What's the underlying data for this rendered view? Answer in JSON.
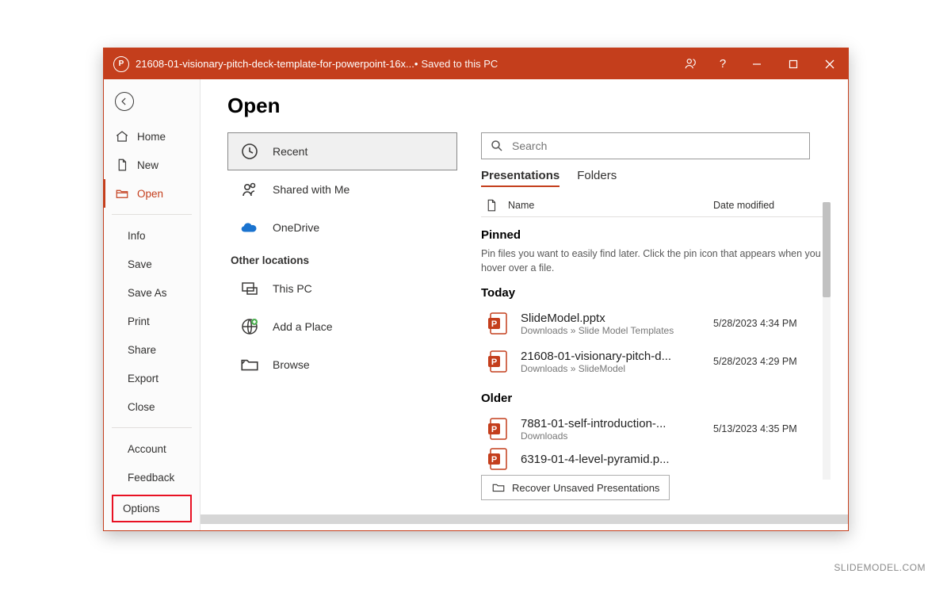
{
  "titlebar": {
    "filename": "21608-01-visionary-pitch-deck-template-for-powerpoint-16x...",
    "separator": " • ",
    "saved_status": "Saved to this PC",
    "help_label": "?"
  },
  "sidebar": {
    "home": "Home",
    "new": "New",
    "open": "Open",
    "info": "Info",
    "save": "Save",
    "save_as": "Save As",
    "print": "Print",
    "share": "Share",
    "export": "Export",
    "close": "Close",
    "account": "Account",
    "feedback": "Feedback",
    "options": "Options"
  },
  "main": {
    "page_title": "Open",
    "locations": {
      "recent": "Recent",
      "shared": "Shared with Me",
      "onedrive": "OneDrive",
      "other_label": "Other locations",
      "this_pc": "This PC",
      "add_place": "Add a Place",
      "browse": "Browse"
    },
    "search": {
      "placeholder": "Search"
    },
    "tabs": {
      "presentations": "Presentations",
      "folders": "Folders"
    },
    "columns": {
      "name": "Name",
      "date": "Date modified"
    },
    "groups": {
      "pinned": "Pinned",
      "pinned_hint": "Pin files you want to easily find later. Click the pin icon that appears when you hover over a file.",
      "today": "Today",
      "older": "Older"
    },
    "files": {
      "today": [
        {
          "name": "SlideModel.pptx",
          "path": "Downloads » Slide Model Templates",
          "date": "5/28/2023 4:34 PM"
        },
        {
          "name": "21608-01-visionary-pitch-d...",
          "path": "Downloads » SlideModel",
          "date": "5/28/2023 4:29 PM"
        }
      ],
      "older": [
        {
          "name": "7881-01-self-introduction-...",
          "path": "Downloads",
          "date": "5/13/2023 4:35 PM"
        },
        {
          "name": "6319-01-4-level-pyramid.p...",
          "path": "",
          "date": ""
        }
      ]
    },
    "recover_label": "Recover Unsaved Presentations"
  },
  "watermark": "SLIDEMODEL.COM"
}
